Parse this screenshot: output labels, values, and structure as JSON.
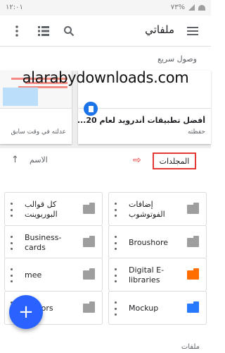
{
  "status_bar": {
    "time": "١٢:٠١",
    "battery": "٧٣%"
  },
  "app_bar": {
    "title": "ملفاتي"
  },
  "quick_access": {
    "label": "وصول سريع",
    "cards": [
      {
        "title": "أفضل تطبيقات أندرويد لعام 20...",
        "subtitle": "حفظته"
      },
      {
        "title": "",
        "subtitle": "عدلته في وقت سابق"
      }
    ]
  },
  "watermark": "alarabydownloads.com",
  "sort_bar": {
    "folders_label": "المجلدات",
    "sort_label": "الاسم",
    "arrow_glyph": "⇨"
  },
  "folders": [
    {
      "name": "إضافات الفوتوشوب",
      "color": "#9e9e9e",
      "icon": "folder-icon"
    },
    {
      "name": "كل قوالب البوربوينت",
      "color": "#9e9e9e",
      "icon": "folder-icon"
    },
    {
      "name": "Broushore",
      "color": "#9e9e9e",
      "icon": "folder-icon"
    },
    {
      "name": "Business-cards",
      "color": "#9e9e9e",
      "icon": "folder-icon"
    },
    {
      "name": "Digital E-libraries",
      "color": "#ff6d00",
      "icon": "folder-icon"
    },
    {
      "name": "mee",
      "color": "#9e9e9e",
      "icon": "shared-folder-icon"
    },
    {
      "name": "Mockup",
      "color": "#2979ff",
      "icon": "folder-icon"
    },
    {
      "name": "vectors",
      "color": "#9e9e9e",
      "icon": "folder-icon"
    }
  ],
  "files_label": "ملفات",
  "fab": {
    "label": "+"
  }
}
